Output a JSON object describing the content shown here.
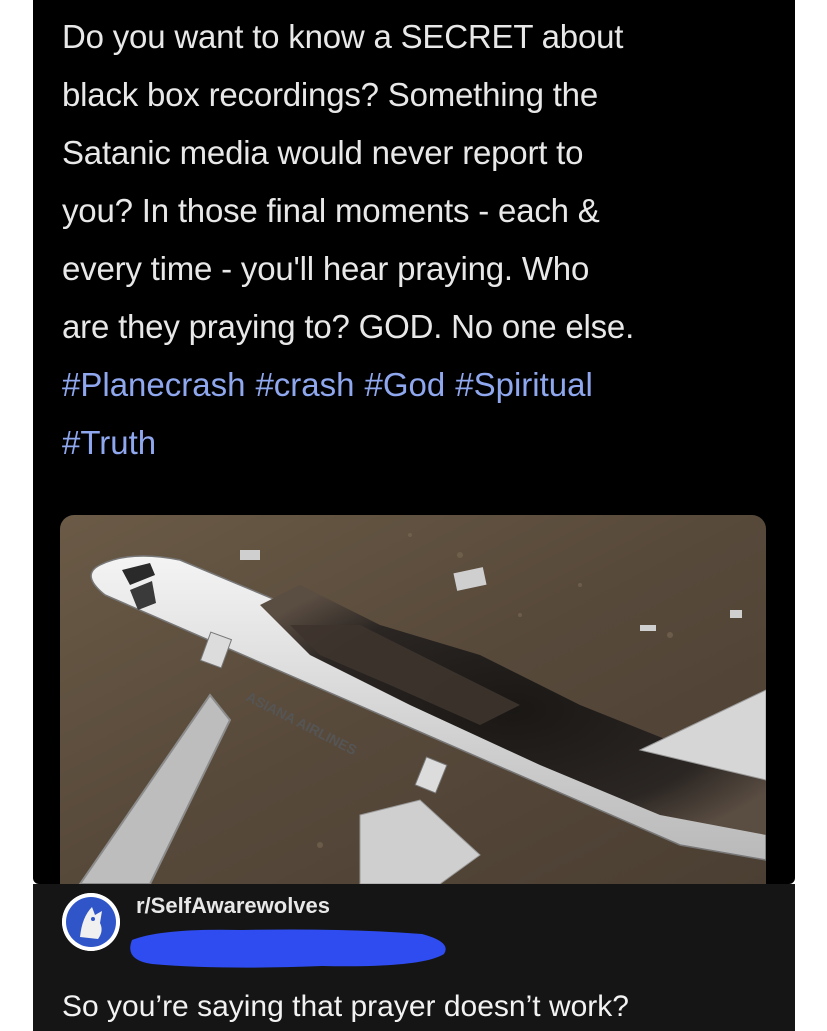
{
  "post": {
    "lines": [
      "Do you want to know a SECRET about",
      "black box recordings? Something the",
      "Satanic media would never report to",
      "you? In those final moments - each &",
      "every time - you'll hear praying. Who",
      "are they praying to? GOD. No one else."
    ],
    "hashtags": [
      "#Planecrash",
      "#crash",
      "#God",
      "#Spiritual",
      "#Truth"
    ],
    "image": {
      "fuselage_text": "ASIANA AIRLINES",
      "description_icon": "crashed-plane-photo"
    }
  },
  "comment": {
    "subreddit": "r/SelfAwarewolves",
    "avatar_icon": "wolf-avatar-icon",
    "text": "So you’re saying that prayer doesn’t work?"
  },
  "colors": {
    "background": "#000000",
    "text": "#e8e8e8",
    "hashtag": "#8fa7ee",
    "redaction": "#2f4cf0",
    "comment_bar": "#151515"
  }
}
